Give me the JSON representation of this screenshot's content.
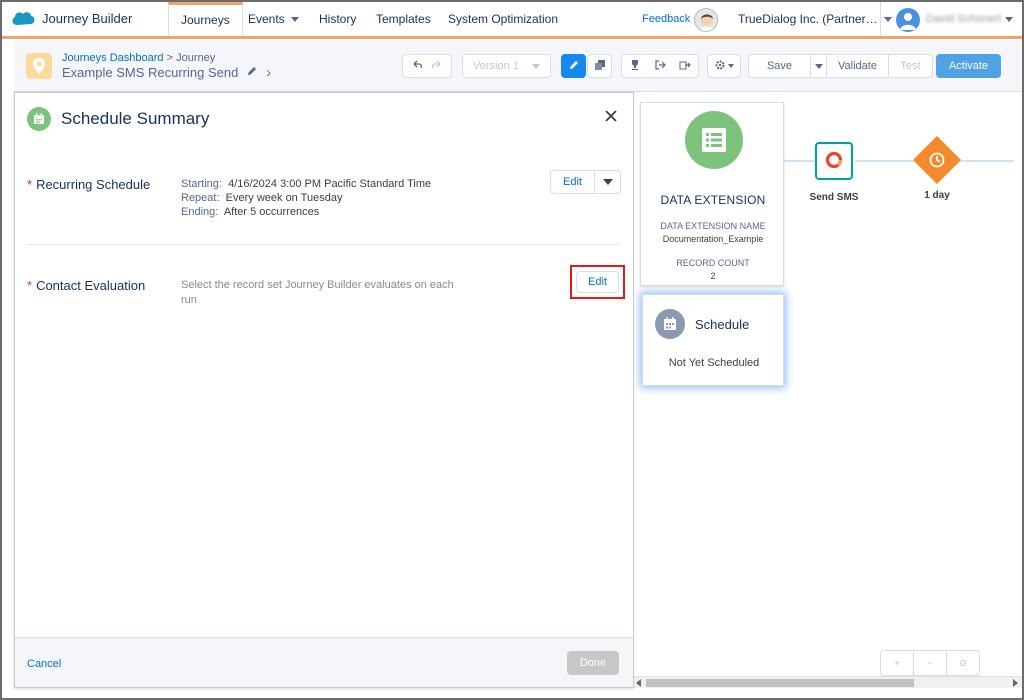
{
  "app": {
    "brand_name": "Journey Builder"
  },
  "nav": {
    "tabs": [
      {
        "label": "Journeys",
        "active": true
      },
      {
        "label": "Events",
        "has_dropdown": true
      },
      {
        "label": "History"
      },
      {
        "label": "Templates"
      },
      {
        "label": "System Optimization"
      }
    ],
    "feedback_label": "Feedback",
    "org_name": "TrueDialog Inc. (Partner…",
    "user_name": "David Schonert"
  },
  "journey": {
    "breadcrumb_link": "Journeys Dashboard",
    "breadcrumb_sep": ">",
    "breadcrumb_current": "Journey",
    "title": "Example SMS Recurring Send",
    "version_label": "Version 1",
    "save_label": "Save",
    "validate_label": "Validate",
    "test_label": "Test",
    "activate_label": "Activate"
  },
  "panel": {
    "title": "Schedule Summary",
    "recurring": {
      "label": "Recurring Schedule",
      "starting_key": "Starting:",
      "starting_value": "4/16/2024 3:00 PM Pacific Standard Time",
      "repeat_key": "Repeat:",
      "repeat_value": "Every week on Tuesday",
      "ending_key": "Ending:",
      "ending_value": "After 5 occurrences",
      "edit_label": "Edit"
    },
    "contact": {
      "label": "Contact Evaluation",
      "description": "Select the record set Journey Builder evaluates on each run",
      "edit_label": "Edit"
    },
    "required_marker": "*",
    "cancel_label": "Cancel",
    "done_label": "Done"
  },
  "canvas": {
    "data_extension": {
      "title": "DATA EXTENSION",
      "name_label": "DATA EXTENSION NAME",
      "name_value": "Documentation_Example",
      "count_label": "RECORD COUNT",
      "count_value": "2"
    },
    "send_sms_label": "Send SMS",
    "wait_label": "1 day",
    "schedule": {
      "title": "Schedule",
      "status": "Not Yet Scheduled"
    }
  },
  "colors": {
    "accent_orange": "#f4a26b",
    "link_blue": "#0070d2",
    "entry_green": "#7dc37d",
    "wait_orange": "#f38a2c",
    "sms_teal": "#00a1a1",
    "highlight_red": "#e11a1a",
    "activate_blue": "#4fa3e4"
  },
  "icons": {
    "brand": "salesforce-cloud-icon",
    "journey": "map-pin-icon",
    "schedule": "calendar-icon",
    "data_extension": "list-icon",
    "send_sms": "sms-ring-icon",
    "wait": "clock-icon"
  }
}
